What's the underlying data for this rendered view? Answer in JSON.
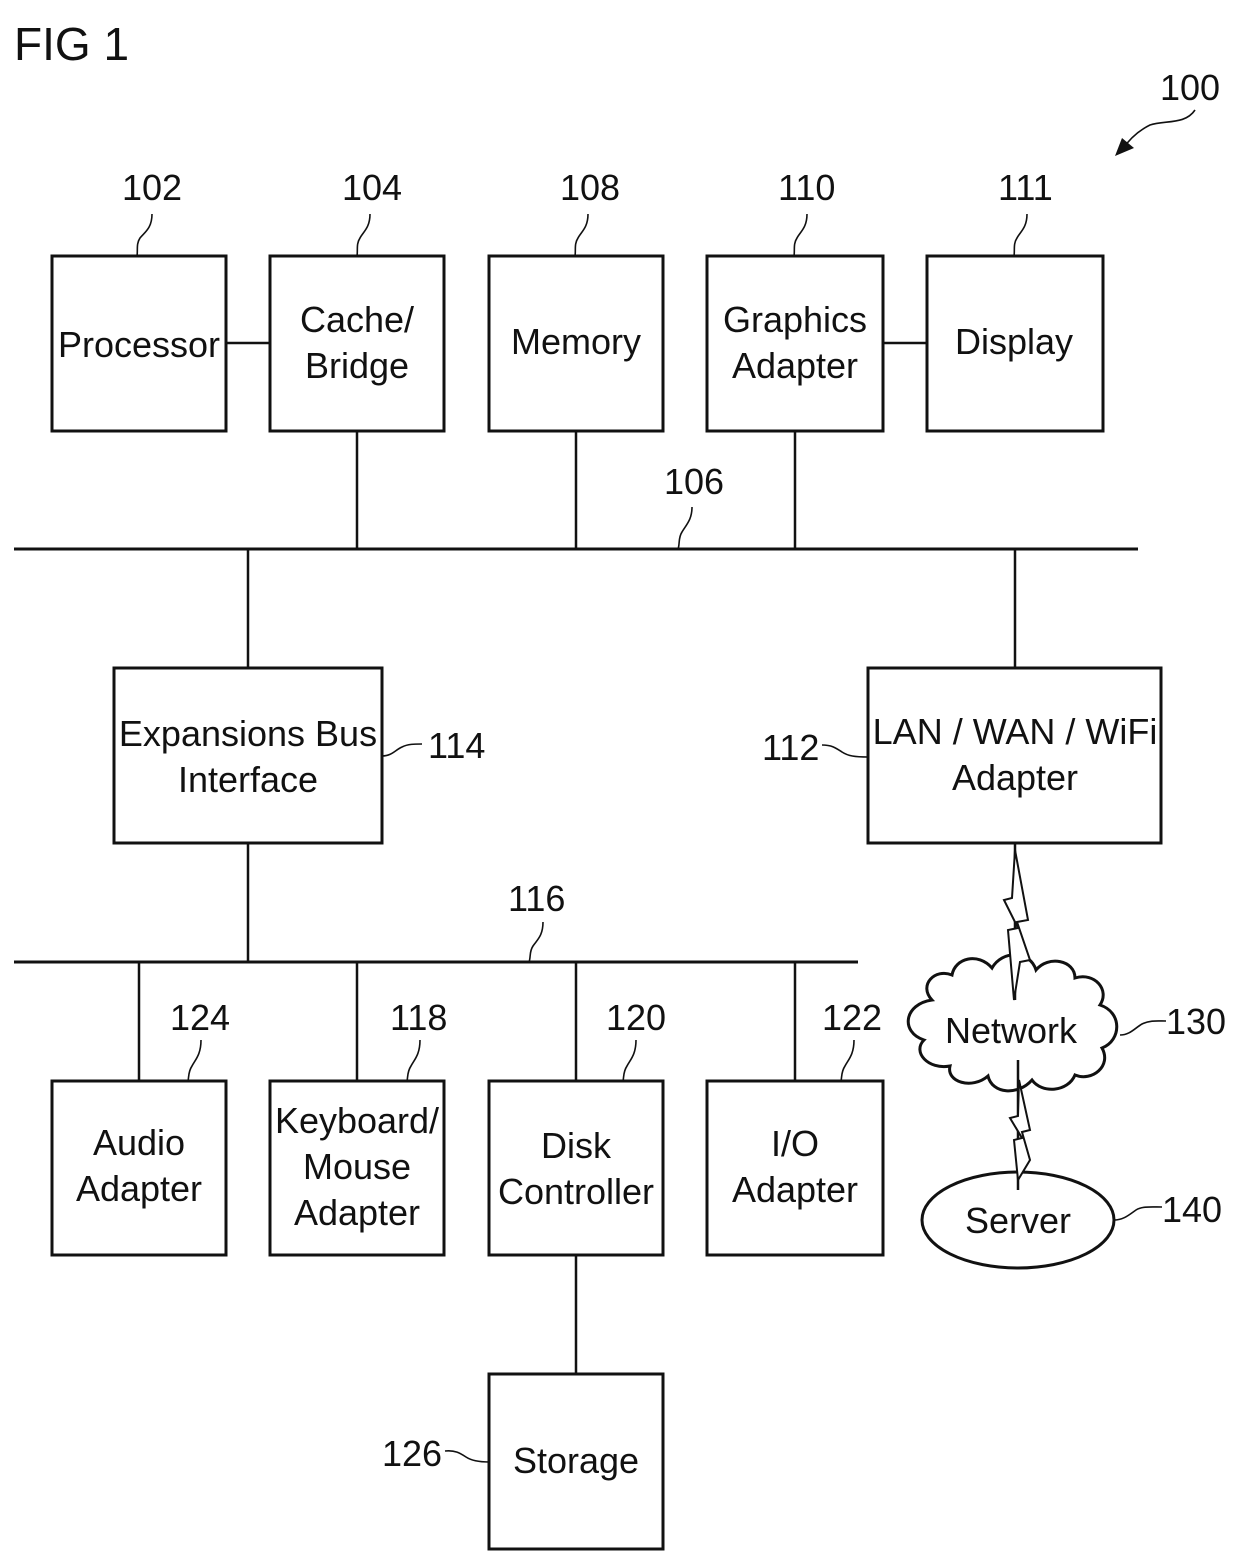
{
  "figure": {
    "title": "FIG 1",
    "system_ref": "100"
  },
  "buses": {
    "system_bus_ref": "106",
    "expansion_bus_ref": "116"
  },
  "blocks": {
    "processor": {
      "ref": "102",
      "lines": [
        "Processor"
      ]
    },
    "cache_bridge": {
      "ref": "104",
      "lines": [
        "Cache/",
        "Bridge"
      ]
    },
    "memory": {
      "ref": "108",
      "lines": [
        "Memory"
      ]
    },
    "graphics_adapter": {
      "ref": "110",
      "lines": [
        "Graphics",
        "Adapter"
      ]
    },
    "display": {
      "ref": "111",
      "lines": [
        "Display"
      ]
    },
    "expansion_bus_interface": {
      "ref": "114",
      "lines": [
        "Expansions Bus",
        "Interface"
      ]
    },
    "lan_wan_wifi_adapter": {
      "ref": "112",
      "lines": [
        "LAN / WAN / WiFi",
        "Adapter"
      ]
    },
    "audio_adapter": {
      "ref": "124",
      "lines": [
        "Audio",
        "Adapter"
      ]
    },
    "keyboard_mouse_adapter": {
      "ref": "118",
      "lines": [
        "Keyboard/",
        "Mouse",
        "Adapter"
      ]
    },
    "disk_controller": {
      "ref": "120",
      "lines": [
        "Disk",
        "Controller"
      ]
    },
    "io_adapter": {
      "ref": "122",
      "lines": [
        "I/O",
        "Adapter"
      ]
    },
    "storage": {
      "ref": "126",
      "lines": [
        "Storage"
      ]
    },
    "network": {
      "ref": "130",
      "lines": [
        "Network"
      ]
    },
    "server": {
      "ref": "140",
      "lines": [
        "Server"
      ]
    }
  }
}
